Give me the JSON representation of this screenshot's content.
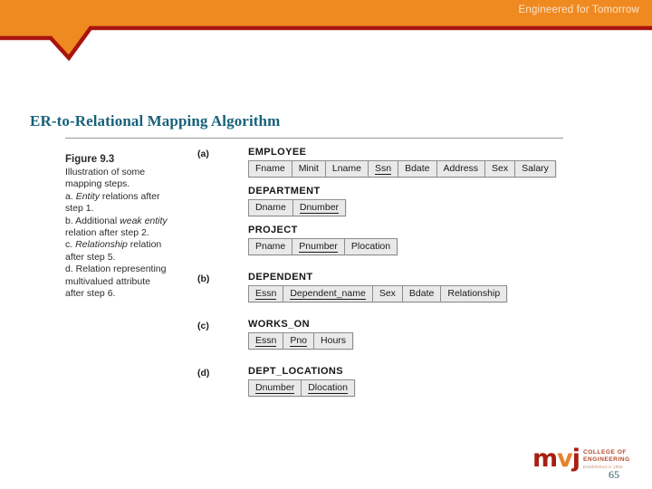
{
  "header": {
    "tagline": "Engineered for Tomorrow",
    "band_color": "#ef8a21",
    "rule_color": "#a81410"
  },
  "slide": {
    "title": "ER-to-Relational Mapping Algorithm",
    "title_color": "#17627a",
    "page_number": "65"
  },
  "figure": {
    "caption": {
      "title": "Figure 9.3",
      "lines": [
        {
          "parts": [
            {
              "text": "Illustration of some",
              "italic": false
            }
          ]
        },
        {
          "parts": [
            {
              "text": "mapping steps.",
              "italic": false
            }
          ]
        },
        {
          "parts": [
            {
              "text": "a. ",
              "italic": false
            },
            {
              "text": "Entity",
              "italic": true
            },
            {
              "text": " relations after",
              "italic": false
            }
          ]
        },
        {
          "parts": [
            {
              "text": "step 1.",
              "italic": false
            }
          ]
        },
        {
          "parts": [
            {
              "text": "b. Additional ",
              "italic": false
            },
            {
              "text": "weak entity",
              "italic": true
            }
          ]
        },
        {
          "parts": [
            {
              "text": "relation after step 2.",
              "italic": false
            }
          ]
        },
        {
          "parts": [
            {
              "text": "c. ",
              "italic": false
            },
            {
              "text": "Relationship",
              "italic": true
            },
            {
              "text": " relation",
              "italic": false
            }
          ]
        },
        {
          "parts": [
            {
              "text": "after step 5.",
              "italic": false
            }
          ]
        },
        {
          "parts": [
            {
              "text": "d. Relation representing",
              "italic": false
            }
          ]
        },
        {
          "parts": [
            {
              "text": "multivalued attribute",
              "italic": false
            }
          ]
        },
        {
          "parts": [
            {
              "text": "after step 6.",
              "italic": false
            }
          ]
        }
      ]
    },
    "groups": [
      {
        "label": "(a)",
        "relations": [
          {
            "name": "EMPLOYEE",
            "attributes": [
              {
                "name": "Fname",
                "key": false
              },
              {
                "name": "Minit",
                "key": false
              },
              {
                "name": "Lname",
                "key": false
              },
              {
                "name": "Ssn",
                "key": true
              },
              {
                "name": "Bdate",
                "key": false
              },
              {
                "name": "Address",
                "key": false
              },
              {
                "name": "Sex",
                "key": false
              },
              {
                "name": "Salary",
                "key": false
              }
            ]
          },
          {
            "name": "DEPARTMENT",
            "attributes": [
              {
                "name": "Dname",
                "key": false
              },
              {
                "name": "Dnumber",
                "key": true
              }
            ]
          },
          {
            "name": "PROJECT",
            "attributes": [
              {
                "name": "Pname",
                "key": false
              },
              {
                "name": "Pnumber",
                "key": true
              },
              {
                "name": "Plocation",
                "key": false
              }
            ]
          }
        ]
      },
      {
        "label": "(b)",
        "relations": [
          {
            "name": "DEPENDENT",
            "attributes": [
              {
                "name": "Essn",
                "key": true
              },
              {
                "name": "Dependent_name",
                "key": true
              },
              {
                "name": "Sex",
                "key": false
              },
              {
                "name": "Bdate",
                "key": false
              },
              {
                "name": "Relationship",
                "key": false
              }
            ]
          }
        ]
      },
      {
        "label": "(c)",
        "relations": [
          {
            "name": "WORKS_ON",
            "attributes": [
              {
                "name": "Essn",
                "key": true
              },
              {
                "name": "Pno",
                "key": true
              },
              {
                "name": "Hours",
                "key": false
              }
            ]
          }
        ]
      },
      {
        "label": "(d)",
        "relations": [
          {
            "name": "DEPT_LOCATIONS",
            "attributes": [
              {
                "name": "Dnumber",
                "key": true
              },
              {
                "name": "Dlocation",
                "key": true
              }
            ]
          }
        ]
      }
    ]
  },
  "logo": {
    "mark_m": "m",
    "mark_v": "v",
    "mark_j": "j",
    "line1": "COLLEGE OF",
    "line2": "ENGINEERING",
    "line3": "Established in 1982",
    "color_dark": "#a81f12",
    "color_orange": "#e8812b"
  }
}
